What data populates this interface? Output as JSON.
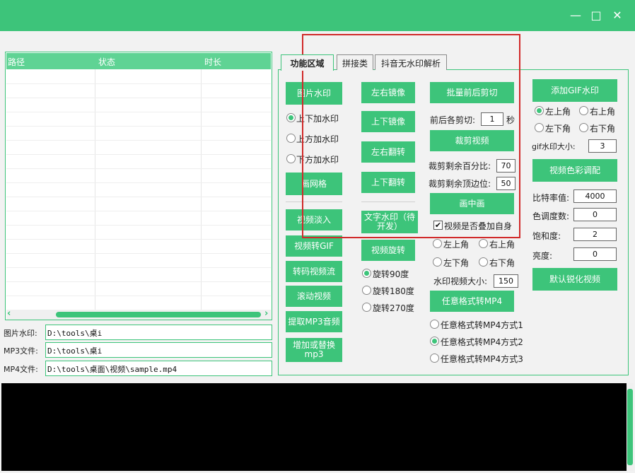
{
  "window": {
    "minimize_glyph": "—",
    "maximize_glyph": "□",
    "close_glyph": "✕",
    "accent_color": "#3dc47a"
  },
  "file_list": {
    "columns": [
      "路径",
      "状态",
      "时长"
    ],
    "scroll_left": "‹",
    "scroll_right": "›"
  },
  "paths": {
    "image_label": "图片水印:",
    "image_value": "D:\\tools\\桌i",
    "mp3_label": "MP3文件:",
    "mp3_value": "D:\\tools\\桌i",
    "mp4_label": "MP4文件:",
    "mp4_value": "D:\\tools\\桌面\\视频\\sample.mp4"
  },
  "tabs": [
    "功能区域",
    "拼接类",
    "抖音无水印解析"
  ],
  "col1": {
    "image_watermark": "图片水印",
    "radio_top_bottom": "上下加水印",
    "radio_top": "上方加水印",
    "radio_bottom": "下方加水印",
    "draw_grid": "画网格",
    "fade_in": "视频淡入",
    "to_gif": "视频转GIF",
    "transcode_stream": "转码视频流",
    "scroll_video": "滚动视频",
    "extract_mp3": "提取MP3音频",
    "add_replace_mp3": "增加或替换mp3"
  },
  "col2": {
    "mirror_lr": "左右镜像",
    "mirror_tb": "上下镜像",
    "flip_lr": "左右翻转",
    "flip_tb": "上下翻转",
    "text_watermark": "文字水印（待开发）",
    "rotate_video": "视频旋转",
    "rot90": "旋转90度",
    "rot180": "旋转180度",
    "rot270": "旋转270度"
  },
  "col3": {
    "batch_trim": "批量前后剪切",
    "trim_label": "前后各剪切:",
    "trim_value": "1",
    "trim_unit": "秒",
    "crop_video": "裁剪视频",
    "crop_percent_label": "裁剪剩余百分比:",
    "crop_percent_value": "70",
    "crop_top_label": "裁剪剩余顶边位:",
    "crop_top_value": "50",
    "pip": "画中画",
    "overlay_self": "视频是否叠加自身",
    "overlay_checked": "✔",
    "pos_tl": "左上角",
    "pos_tr": "右上角",
    "pos_bl": "左下角",
    "pos_br": "右下角",
    "wm_size_label": "水印视频大小:",
    "wm_size_value": "150",
    "any_to_mp4": "任意格式转MP4",
    "mode1": "任意格式转MP4方式1",
    "mode2": "任意格式转MP4方式2",
    "mode3": "任意格式转MP4方式3"
  },
  "col4": {
    "add_gif_wm": "添加GIF水印",
    "pos_tl": "左上角",
    "pos_tr": "右上角",
    "pos_bl": "左下角",
    "pos_br": "右下角",
    "gif_size_label": "gif水印大小:",
    "gif_size_value": "3",
    "color_adjust": "视频色彩调配",
    "bitrate_label": "比特率值:",
    "bitrate_value": "4000",
    "hue_label": "色调度数:",
    "hue_value": "0",
    "saturation_label": "饱和度:",
    "saturation_value": "2",
    "brightness_label": "亮度:",
    "brightness_value": "0",
    "default_sharpen": "默认锐化视频"
  }
}
